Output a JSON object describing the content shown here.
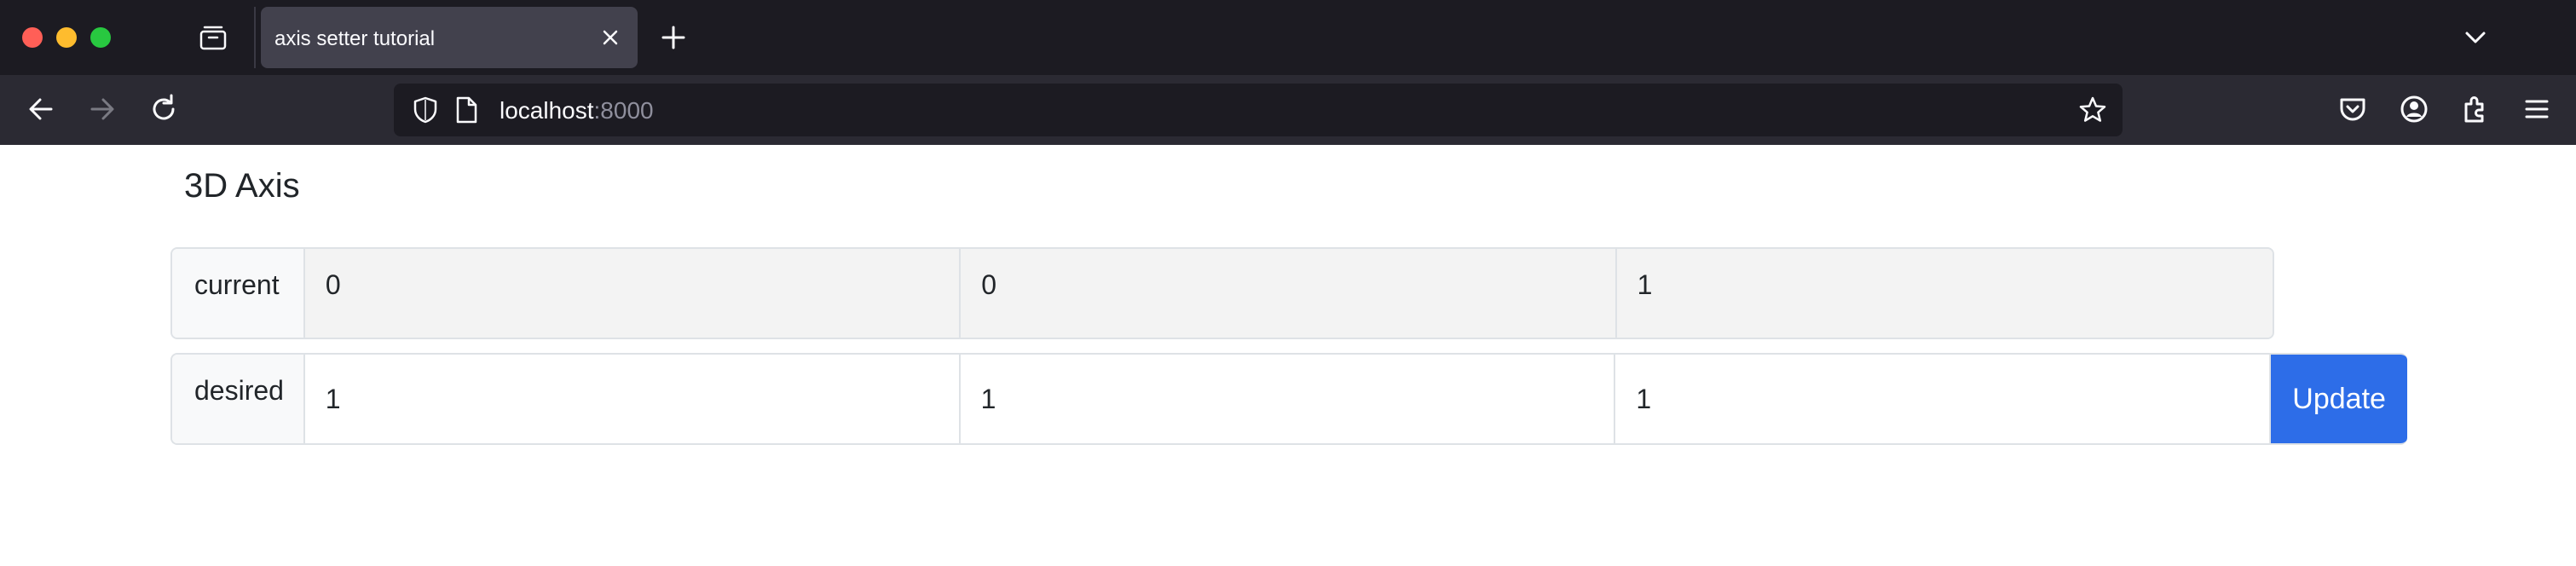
{
  "browser": {
    "tab_title": "axis setter tutorial",
    "url_host": "localhost",
    "url_port": ":8000"
  },
  "page": {
    "title": "3D Axis",
    "current": {
      "label": "current",
      "values": [
        "0",
        "0",
        "1"
      ]
    },
    "desired": {
      "label": "desired",
      "values": [
        "1",
        "1",
        "1"
      ]
    },
    "update_label": "Update"
  },
  "colors": {
    "accent": "#2d6de8",
    "chrome_dark": "#1c1b22",
    "toolbar": "#2b2a33"
  }
}
